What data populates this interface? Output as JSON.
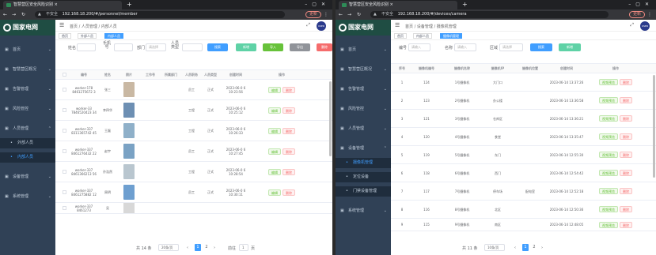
{
  "left": {
    "tab_title": "智慧营区安全风险识别 ×",
    "url_insecure": "不安全",
    "url": "192.168.18.200/#/personnel/member",
    "update_label": "更新",
    "logo_text": "国家电网",
    "logo_sub": "STATE GRID",
    "menu": [
      {
        "label": "首页"
      },
      {
        "label": "智慧营区概况"
      },
      {
        "label": "告警管理"
      },
      {
        "label": "风险管控"
      },
      {
        "label": "人员管理",
        "open": true
      },
      {
        "label": "外部人员",
        "sub": true
      },
      {
        "label": "内部人员",
        "sub": true,
        "active": true
      },
      {
        "label": "设备管理"
      },
      {
        "label": "系统管理"
      }
    ],
    "breadcrumb": "首页 / 人员管理 / 内部人员",
    "tags": [
      "首页",
      "外部人员",
      "内部人员"
    ],
    "filter": {
      "name_label": "姓名",
      "phone_label": "手机号",
      "dept_label": "部门",
      "dept_placeholder": "请选择",
      "type_label": "人员类型",
      "search_btn": "搜索",
      "add_btn": "新增",
      "import_btn": "导入",
      "export_btn": "导出",
      "delete_btn": "删除"
    },
    "columns": [
      "",
      "编号",
      "姓名",
      "照片",
      "工作号",
      "所属部门",
      "人员职务",
      "人员类型",
      "创建时间",
      "操作"
    ],
    "rows": [
      {
        "id": "worker-178 8461275672 3",
        "name": "张三",
        "dept": "",
        "job": "员工",
        "type": "正式",
        "time": "2023-06-0 6 10:23:56"
      },
      {
        "id": "worker-33 7846520423 34",
        "name": "李四华",
        "dept": "",
        "job": "工程",
        "type": "正式",
        "time": "2023-06-0 6 10:25:12"
      },
      {
        "id": "worker-337 8311365742 45",
        "name": "王磊",
        "dept": "",
        "job": "工程",
        "type": "正式",
        "time": "2023-06-0 6 10:26:33"
      },
      {
        "id": "worker-337 8461276432 22",
        "name": "赵宇",
        "dept": "",
        "job": "员工",
        "type": "正式",
        "time": "2023-06-0 6 10:27:45"
      },
      {
        "id": "worker-337 8461366213 56",
        "name": "孙浩然",
        "dept": "",
        "job": "工程",
        "type": "正式",
        "time": "2023-06-0 6 10:28:54"
      },
      {
        "id": "worker-337 8461275882 12",
        "name": "周明",
        "dept": "",
        "job": "员工",
        "type": "正式",
        "time": "2023-06-0 6 10:30:11"
      },
      {
        "id": "worker-337 8461273",
        "name": "吴",
        "dept": "",
        "job": "",
        "type": "",
        "time": ""
      }
    ],
    "op_edit": "编辑",
    "op_delete": "删除",
    "pager": {
      "total": "共 14 条",
      "size": "20条/页",
      "pages": [
        "1",
        "2",
        "3"
      ],
      "goto": "前往",
      "goto_val": "1",
      "unit": "页"
    }
  },
  "right": {
    "tab_title": "智慧营区安全风险识别 ×",
    "url_insecure": "不安全",
    "url": "192.168.18.200/#/devices/camera",
    "update_label": "更新",
    "logo_text": "国家电网",
    "logo_sub": "STATE GRID",
    "menu": [
      {
        "label": "首页"
      },
      {
        "label": "智慧营区概况"
      },
      {
        "label": "告警管理"
      },
      {
        "label": "风险管控"
      },
      {
        "label": "人员管理"
      },
      {
        "label": "设备管理",
        "open": true
      },
      {
        "label": "摄像机管理",
        "sub": true,
        "active": true
      },
      {
        "label": "定位设备",
        "sub": true
      },
      {
        "label": "门禁设备管理",
        "sub": true
      },
      {
        "label": "系统管理"
      }
    ],
    "breadcrumb": "首页 / 设备管理 / 摄像机管理",
    "tags": [
      "首页",
      "内部人员",
      "摄像机管理"
    ],
    "filter": {
      "no_label": "编号",
      "no_placeholder": "请输入",
      "name_label": "名称",
      "name_placeholder": "请输入",
      "area_label": "区域",
      "area_placeholder": "请选择",
      "search_btn": "搜索",
      "reset_btn": "新增"
    },
    "columns": [
      "序号",
      "摄像机编号",
      "摄像机名称",
      "摄像机IP",
      "摄像机位置",
      "创建时间",
      "操作"
    ],
    "rows": [
      {
        "no": "1",
        "code": "124",
        "name": "1号摄像机",
        "ip": "大门口",
        "pos": "",
        "time": "2023-06-14 13:37:26"
      },
      {
        "no": "2",
        "code": "123",
        "name": "2号摄像机",
        "ip": "办公楼",
        "pos": "",
        "time": "2023-06-14 13:36:58"
      },
      {
        "no": "3",
        "code": "121",
        "name": "3号摄像机",
        "ip": "仓库区",
        "pos": "",
        "time": "2023-06-14 13:36:21"
      },
      {
        "no": "4",
        "code": "120",
        "name": "4号摄像机",
        "ip": "食堂",
        "pos": "",
        "time": "2023-06-14 13:35:47"
      },
      {
        "no": "5",
        "code": "119",
        "name": "5号摄像机",
        "ip": "东门",
        "pos": "",
        "time": "2023-06-14 12:55:30"
      },
      {
        "no": "6",
        "code": "118",
        "name": "6号摄像机",
        "ip": "西门",
        "pos": "",
        "time": "2023-06-14 12:54:42"
      },
      {
        "no": "7",
        "code": "117",
        "name": "7号摄像机",
        "ip": "停车场",
        "pos": "配电室",
        "time": "2023-06-14 12:52:18"
      },
      {
        "no": "8",
        "code": "116",
        "name": "8号摄像机",
        "ip": "北区",
        "pos": "",
        "time": "2023-06-14 12:50:36"
      },
      {
        "no": "9",
        "code": "115",
        "name": "9号摄像机",
        "ip": "南区",
        "pos": "",
        "time": "2023-06-14 12:48:05"
      }
    ],
    "op_edit": "视频预览",
    "op_delete": "删除",
    "pager": {
      "total": "共 11 条",
      "size": "10条/页",
      "pages": [
        "1",
        "2"
      ]
    }
  }
}
